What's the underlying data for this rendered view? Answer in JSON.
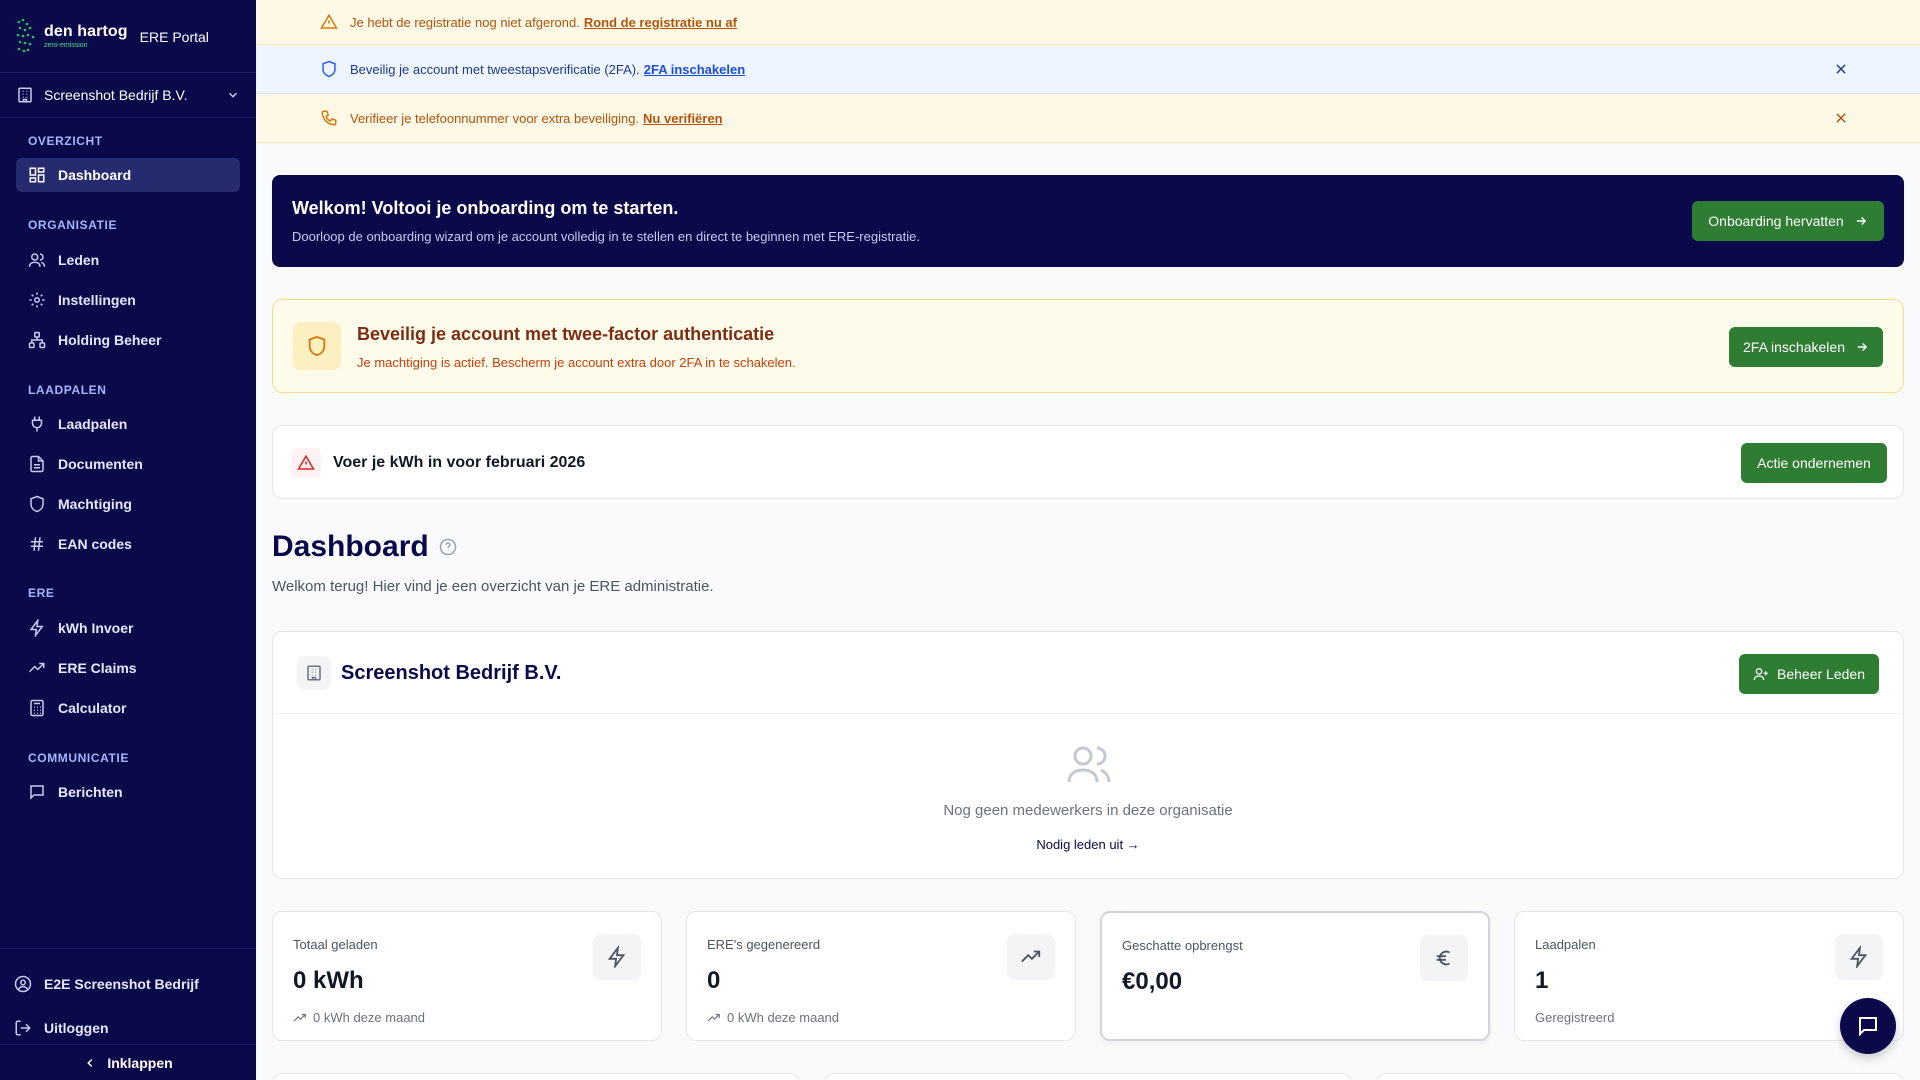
{
  "brand": {
    "name": "den hartog",
    "sub": "zero-emission",
    "portal": "ERE Portal"
  },
  "org_switcher": {
    "label": "Screenshot Bedrijf B.V."
  },
  "nav": {
    "overzicht": {
      "title": "OVERZICHT",
      "dashboard": "Dashboard"
    },
    "organisatie": {
      "title": "ORGANISATIE",
      "leden": "Leden",
      "instellingen": "Instellingen",
      "holding": "Holding Beheer"
    },
    "laadpalen": {
      "title": "LAADPALEN",
      "laadpalen": "Laadpalen",
      "documenten": "Documenten",
      "machtiging": "Machtiging",
      "ean": "EAN codes"
    },
    "ere": {
      "title": "ERE",
      "kwh": "kWh Invoer",
      "claims": "ERE Claims",
      "calculator": "Calculator"
    },
    "communicatie": {
      "title": "COMMUNICATIE",
      "berichten": "Berichten"
    }
  },
  "sidebar_bottom": {
    "account": "E2E Screenshot Bedrijf",
    "logout": "Uitloggen",
    "collapse": "Inklappen"
  },
  "banners": {
    "registration": {
      "text": "Je hebt de registratie nog niet afgerond.",
      "link": "Rond de registratie nu af"
    },
    "twofa": {
      "text": "Beveilig je account met tweestapsverificatie (2FA).",
      "link": "2FA inschakelen"
    },
    "phone": {
      "text": "Verifieer je telefoonnummer voor extra beveiliging.",
      "link": "Nu verifiëren"
    }
  },
  "welcome_card": {
    "title": "Welkom! Voltooi je onboarding om te starten.",
    "subtitle": "Doorloop de onboarding wizard om je account volledig in te stellen en direct te beginnen met ERE-registratie.",
    "button": "Onboarding hervatten"
  },
  "twofa_card": {
    "title": "Beveilig je account met twee-factor authenticatie",
    "subtitle": "Je machtiging is actief. Bescherm je account extra door 2FA in te schakelen.",
    "button": "2FA inschakelen"
  },
  "kwh_card": {
    "title": "Voer je kWh in voor februari 2026",
    "button": "Actie ondernemen"
  },
  "dashboard": {
    "title": "Dashboard",
    "subtitle": "Welkom terug! Hier vind je een overzicht van je ERE administratie."
  },
  "org_card": {
    "name": "Screenshot Bedrijf B.V.",
    "button": "Beheer Leden",
    "empty_text": "Nog geen medewerkers in deze organisatie",
    "invite_link": "Nodig leden uit →"
  },
  "stats": [
    {
      "label": "Totaal geladen",
      "value": "0 kWh",
      "sub": "0 kWh deze maand",
      "icon": "lightning-icon"
    },
    {
      "label": "ERE's gegenereerd",
      "value": "0",
      "sub": "0 kWh deze maand",
      "icon": "trending-up-icon"
    },
    {
      "label": "Geschatte opbrengst",
      "value": "€0,00",
      "sub": "",
      "icon": "euro-icon"
    },
    {
      "label": "Laadpalen",
      "value": "1",
      "sub": "Geregistreerd",
      "icon": "lightning-icon"
    }
  ],
  "colors": {
    "navy": "#0a0a4a",
    "green": "#2e7d32",
    "warning": "#b45309",
    "info": "#1d4ed8",
    "danger": "#dc2626"
  }
}
